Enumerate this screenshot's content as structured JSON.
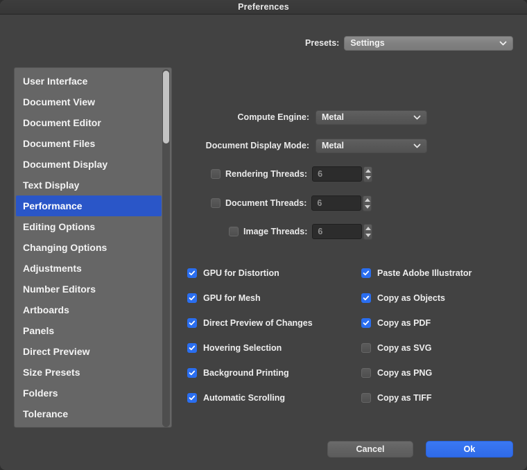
{
  "window": {
    "title": "Preferences"
  },
  "presets": {
    "label": "Presets:",
    "value": "Settings",
    "chevron_icon": "chevron-down-icon"
  },
  "sidebar": {
    "selected": "Performance",
    "items": [
      {
        "label": "User Interface"
      },
      {
        "label": "Document View"
      },
      {
        "label": "Document Editor"
      },
      {
        "label": "Document Files"
      },
      {
        "label": "Document Display"
      },
      {
        "label": "Text Display"
      },
      {
        "label": "Performance"
      },
      {
        "label": "Editing Options"
      },
      {
        "label": "Changing Options"
      },
      {
        "label": "Adjustments"
      },
      {
        "label": "Number Editors"
      },
      {
        "label": "Artboards"
      },
      {
        "label": "Panels"
      },
      {
        "label": "Direct Preview"
      },
      {
        "label": "Size Presets"
      },
      {
        "label": "Folders"
      },
      {
        "label": "Tolerance"
      }
    ]
  },
  "performance": {
    "compute_engine": {
      "label": "Compute Engine:",
      "value": "Metal"
    },
    "document_display_mode": {
      "label": "Document Display Mode:",
      "value": "Metal"
    },
    "threads": [
      {
        "label": "Rendering Threads:",
        "value": "6",
        "checked": false
      },
      {
        "label": "Document Threads:",
        "value": "6",
        "checked": false
      },
      {
        "label": "Image Threads:",
        "value": "6",
        "checked": false
      }
    ],
    "options_left": [
      {
        "label": "GPU for Distortion",
        "checked": true
      },
      {
        "label": "GPU for Mesh",
        "checked": true
      },
      {
        "label": "Direct Preview of Changes",
        "checked": true
      },
      {
        "label": "Hovering Selection",
        "checked": true
      },
      {
        "label": "Background Printing",
        "checked": true
      },
      {
        "label": "Automatic Scrolling",
        "checked": true
      }
    ],
    "options_right": [
      {
        "label": "Paste Adobe Illustrator",
        "checked": true
      },
      {
        "label": "Copy as Objects",
        "checked": true
      },
      {
        "label": "Copy as PDF",
        "checked": true
      },
      {
        "label": "Copy as SVG",
        "checked": false
      },
      {
        "label": "Copy as PNG",
        "checked": false
      },
      {
        "label": "Copy as TIFF",
        "checked": false
      }
    ]
  },
  "footer": {
    "cancel_label": "Cancel",
    "ok_label": "Ok"
  },
  "colors": {
    "window_background": "#424242",
    "sidebar_background": "#666666",
    "selection_blue": "#2a56c8",
    "checkbox_blue": "#2a6ef0",
    "default_button_blue": "#3a78f2"
  }
}
